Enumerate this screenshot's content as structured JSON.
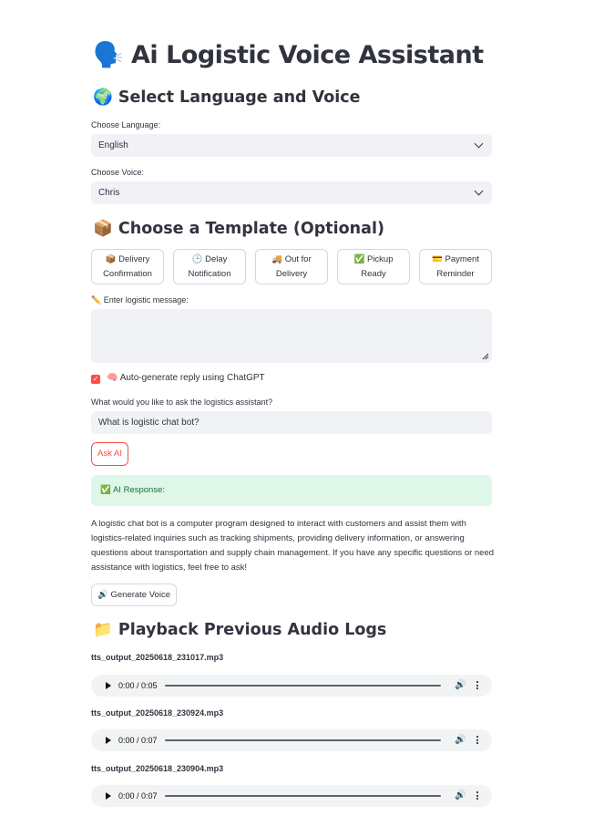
{
  "header": {
    "icon": "🗣️",
    "title": "Ai Logistic Voice Assistant"
  },
  "language_section": {
    "icon": "🌍",
    "title": "Select Language and Voice",
    "language_label": "Choose Language:",
    "language_value": "English",
    "voice_label": "Choose Voice:",
    "voice_value": "Chris"
  },
  "template_section": {
    "icon": "📦",
    "title": "Choose a Template (Optional)",
    "buttons": [
      {
        "icon": "📦",
        "line1": "Delivery",
        "line2": "Confirmation"
      },
      {
        "icon": "🕒",
        "line1": "Delay",
        "line2": "Notification"
      },
      {
        "icon": "🚚",
        "line1": "Out for",
        "line2": "Delivery"
      },
      {
        "icon": "✅",
        "line1": "Pickup",
        "line2": "Ready"
      },
      {
        "icon": "💳",
        "line1": "Payment",
        "line2": "Reminder"
      }
    ]
  },
  "message": {
    "label_icon": "✏️",
    "label": "Enter logistic message:",
    "value": ""
  },
  "auto_reply": {
    "checked": true,
    "icon": "🧠",
    "label": "Auto-generate reply using ChatGPT"
  },
  "question": {
    "label": "What would you like to ask the logistics assistant?",
    "value": "What is logistic chat bot?"
  },
  "ask_button": "Ask AI",
  "ai_response": {
    "icon": "✅",
    "label": "AI Response:",
    "text": "A logistic chat bot is a computer program designed to interact with customers and assist them with logistics-related inquiries such as tracking shipments, providing delivery information, or answering questions about transportation and supply chain management. If you have any specific questions or need assistance with logistics, feel free to ask!"
  },
  "generate_button": {
    "icon": "🔊",
    "label": "Generate Voice"
  },
  "playback": {
    "icon": "📁",
    "title": "Playback Previous Audio Logs",
    "logs": [
      {
        "file": "tts_output_20250618_231017.mp3",
        "time": "0:00 / 0:05"
      },
      {
        "file": "tts_output_20250618_230924.mp3",
        "time": "0:00 / 0:07"
      },
      {
        "file": "tts_output_20250618_230904.mp3",
        "time": "0:00 / 0:07"
      }
    ]
  },
  "colors": {
    "accent": "#ff4b4b",
    "input_bg": "#f0f2f6",
    "success_bg": "#dff7e8",
    "success_text": "#177233"
  }
}
